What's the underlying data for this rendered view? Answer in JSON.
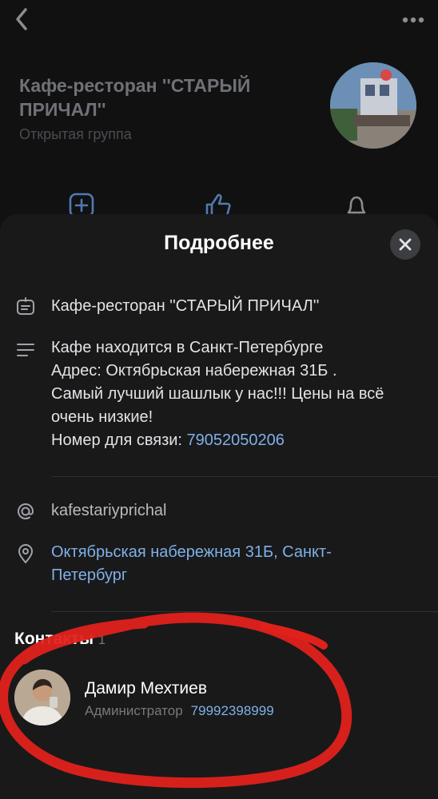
{
  "group": {
    "title": "Кафе-ресторан  ''СТАРЫЙ ПРИЧАЛ''",
    "subtitle": "Открытая группа"
  },
  "sheet": {
    "title": "Подробнее",
    "name_row": "Кафе-ресторан  ''СТАРЫЙ ПРИЧАЛ''",
    "description": {
      "line1": "Кафе находится в Санкт-Петербурге",
      "line2": "Адрес: Октябрьская набережная 31Б .",
      "line3": "Самый лучший шашлык у нас!!! Цены на всё",
      "line4": "очень низкие!",
      "phone_label": "Номер для связи: ",
      "phone": "79052050206"
    },
    "short_name": "kafestariyprichal",
    "address": {
      "line1": "Октябрьская набережная 31Б, Санкт-",
      "line2": "Петербург"
    },
    "contacts": {
      "title": "Контакты",
      "count": "1",
      "items": [
        {
          "name": "Дамир Мехтиев",
          "role": "Администратор",
          "phone": "79992398999"
        }
      ]
    }
  },
  "icons": [
    "back-icon",
    "more-icon",
    "add-post-icon",
    "like-icon",
    "bell-icon",
    "close-icon",
    "info-card-icon",
    "description-icon",
    "at-icon",
    "location-pin-icon"
  ],
  "colors": {
    "accent": "#7fb0e8",
    "annotation": "#e0211b",
    "sheet_bg": "#19191a"
  }
}
